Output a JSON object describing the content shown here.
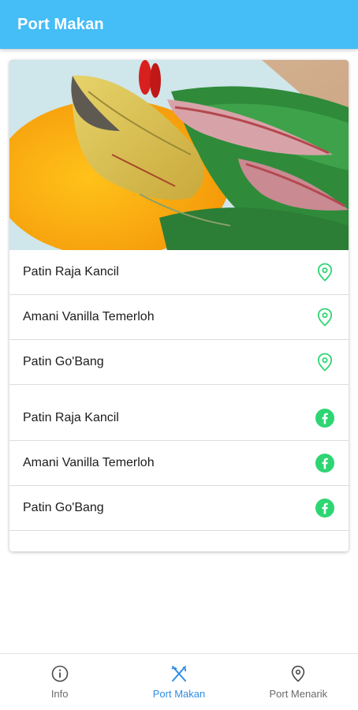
{
  "appbar": {
    "title": "Port Makan"
  },
  "hero": {
    "alt": "Ikan patin masak tempoyak"
  },
  "locations": [
    {
      "label": "Patin Raja Kancil",
      "icon": "map-pin-icon"
    },
    {
      "label": "Amani Vanilla Temerloh",
      "icon": "map-pin-icon"
    },
    {
      "label": "Patin Go'Bang",
      "icon": "map-pin-icon"
    }
  ],
  "facebook": [
    {
      "label": "Patin Raja Kancil",
      "icon": "facebook-icon"
    },
    {
      "label": "Amani Vanilla Temerloh",
      "icon": "facebook-icon"
    },
    {
      "label": "Patin Go'Bang",
      "icon": "facebook-icon"
    }
  ],
  "bottom_nav": [
    {
      "label": "Info",
      "icon": "info-icon",
      "active": false
    },
    {
      "label": "Port Makan",
      "icon": "utensils-icon",
      "active": true
    },
    {
      "label": "Port Menarik",
      "icon": "map-pin-icon",
      "active": false
    }
  ],
  "colors": {
    "appbar": "#45bdf6",
    "accent_green": "#2ed573",
    "active_nav": "#2f8de4",
    "inactive_nav": "#6a6a6a"
  }
}
